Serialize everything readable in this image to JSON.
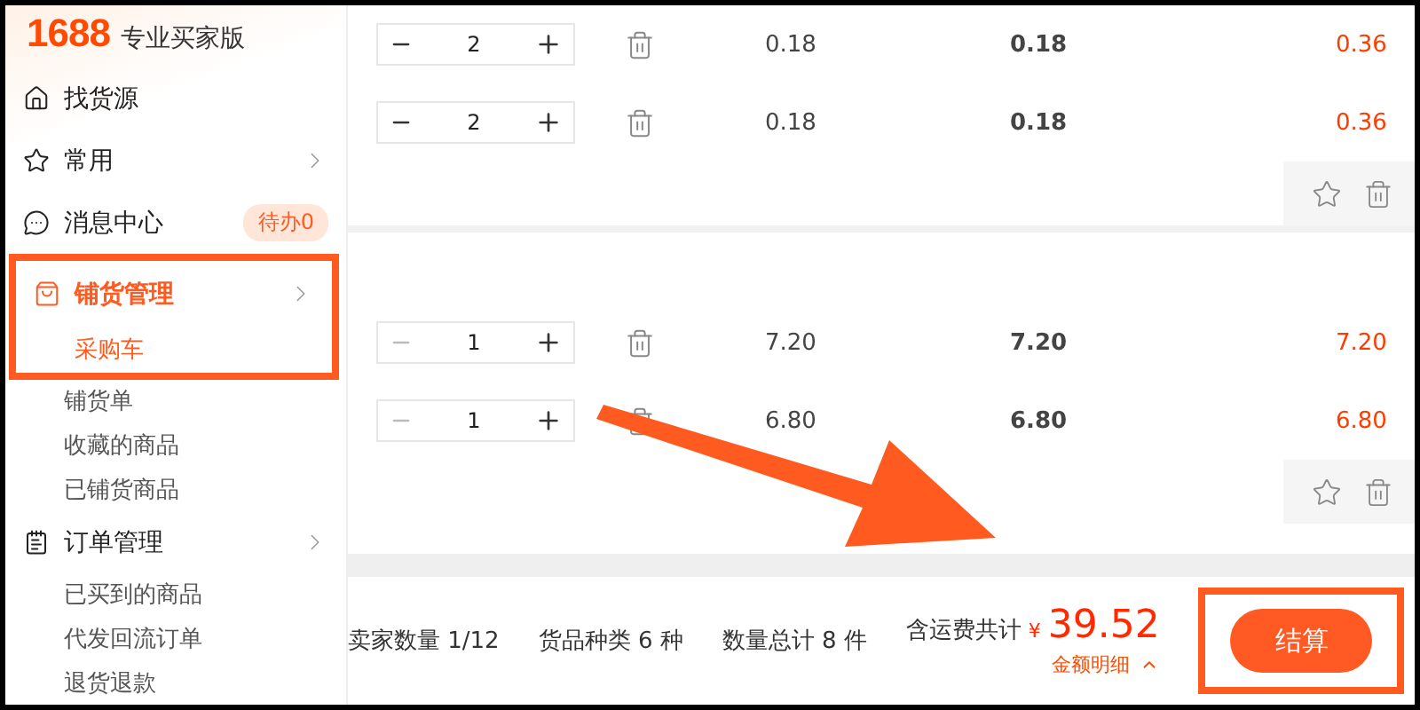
{
  "brand": {
    "logo": "1688",
    "edition": "专业买家版"
  },
  "sidebar": {
    "items": [
      {
        "label": "找货源",
        "selected": false,
        "chevron": false,
        "highlighted": false
      },
      {
        "label": "常用",
        "selected": false,
        "chevron": true,
        "highlighted": false
      },
      {
        "label": "消息中心",
        "selected": false,
        "chevron": false,
        "badge": "待办0",
        "highlighted": false
      },
      {
        "label": "铺货管理",
        "selected": true,
        "chevron": true,
        "highlighted": true,
        "children": [
          {
            "label": "采购车",
            "selected": true,
            "highlighted": true
          },
          {
            "label": "铺货单",
            "selected": false,
            "highlighted": false
          },
          {
            "label": "收藏的商品",
            "selected": false,
            "highlighted": false
          },
          {
            "label": "已铺货商品",
            "selected": false,
            "highlighted": false
          }
        ]
      },
      {
        "label": "订单管理",
        "selected": false,
        "chevron": true,
        "highlighted": false,
        "children": [
          {
            "label": "已买到的商品",
            "selected": false,
            "highlighted": false
          },
          {
            "label": "代发回流订单",
            "selected": false,
            "highlighted": false
          },
          {
            "label": "退货退款",
            "selected": false,
            "highlighted": false
          }
        ]
      }
    ]
  },
  "cart": {
    "groups": [
      {
        "rows": [
          {
            "quantity": "2",
            "minus_disabled": false,
            "unit_price": "0.18",
            "price": "0.18",
            "subtotal": "0.36"
          },
          {
            "quantity": "2",
            "minus_disabled": false,
            "unit_price": "0.18",
            "price": "0.18",
            "subtotal": "0.36"
          }
        ]
      },
      {
        "rows": [
          {
            "quantity": "1",
            "minus_disabled": true,
            "unit_price": "7.20",
            "price": "7.20",
            "subtotal": "7.20"
          },
          {
            "quantity": "1",
            "minus_disabled": true,
            "unit_price": "6.80",
            "price": "6.80",
            "subtotal": "6.80"
          }
        ]
      }
    ]
  },
  "footer": {
    "summary": [
      "卖家数量 1/12",
      "货品种类 6 种",
      "数量总计 8 件"
    ],
    "total_label": "含运费共计",
    "currency": "¥",
    "total": "39.52",
    "details_link": "金额明细",
    "checkout": "结算",
    "checkout_highlighted": true
  },
  "annotations": {
    "arrow": true
  }
}
